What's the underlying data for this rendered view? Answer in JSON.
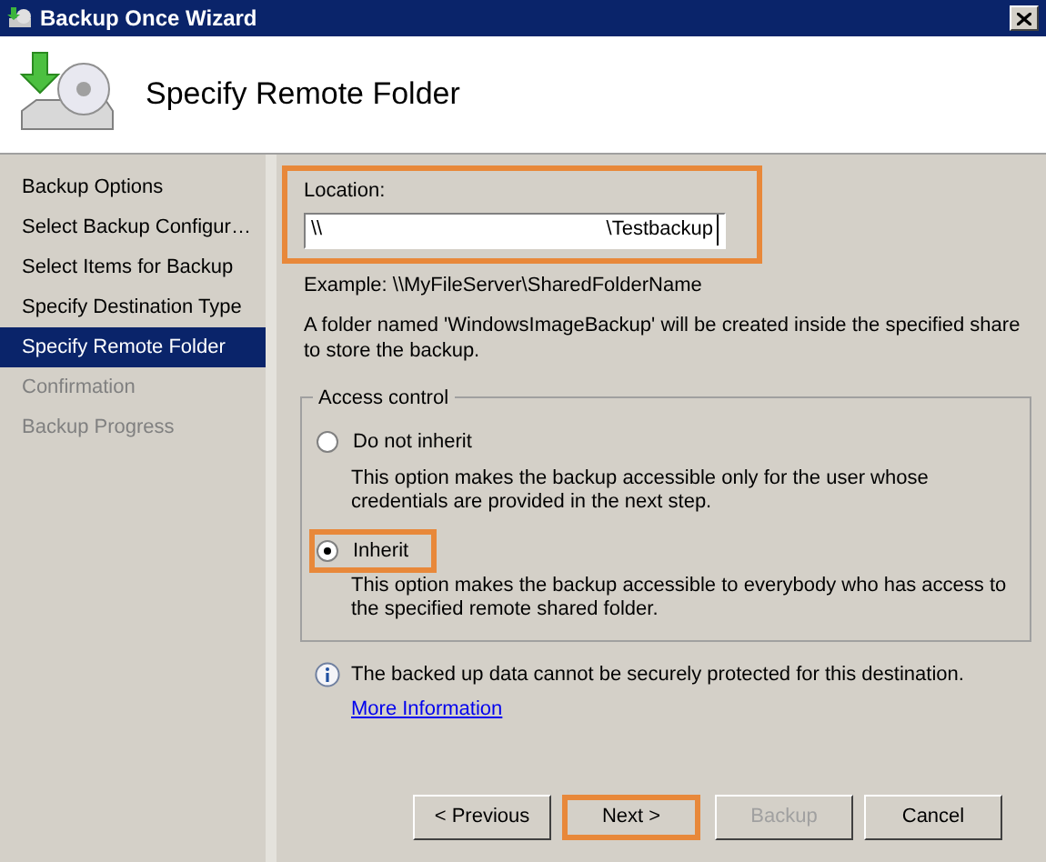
{
  "window": {
    "title": "Backup Once Wizard"
  },
  "header": {
    "title": "Specify Remote Folder"
  },
  "sidebar": {
    "items": [
      {
        "label": "Backup Options",
        "selected": false,
        "disabled": false
      },
      {
        "label": "Select Backup Configur…",
        "selected": false,
        "disabled": false
      },
      {
        "label": "Select Items for Backup",
        "selected": false,
        "disabled": false
      },
      {
        "label": "Specify Destination Type",
        "selected": false,
        "disabled": false
      },
      {
        "label": "Specify Remote Folder",
        "selected": true,
        "disabled": false
      },
      {
        "label": "Confirmation",
        "selected": false,
        "disabled": true
      },
      {
        "label": "Backup Progress",
        "selected": false,
        "disabled": true
      }
    ]
  },
  "location": {
    "label": "Location:",
    "value_parts": [
      "\\\\",
      "\\Testbackup"
    ],
    "highlighted": true
  },
  "example": "Example: \\\\MyFileServer\\SharedFolderName",
  "note": "A folder named 'WindowsImageBackup' will be created inside the specified share to store the backup.",
  "access_control": {
    "title": "Access control",
    "options": [
      {
        "label": "Do not inherit",
        "description": "This option makes the backup accessible only for the user whose credentials are provided in the next step.",
        "selected": false,
        "highlighted": false
      },
      {
        "label": "Inherit",
        "description": "This option makes the backup accessible to everybody who has access to the specified remote shared folder.",
        "selected": true,
        "highlighted": true
      }
    ]
  },
  "info": {
    "text": "The backed up data cannot be securely protected for this destination.",
    "link": "More Information"
  },
  "buttons": [
    {
      "label": "< Previous",
      "disabled": false,
      "highlighted": false
    },
    {
      "label": "Next >",
      "disabled": false,
      "highlighted": true
    },
    {
      "label": "Backup",
      "disabled": true,
      "highlighted": false
    },
    {
      "label": "Cancel",
      "disabled": false,
      "highlighted": false
    }
  ]
}
